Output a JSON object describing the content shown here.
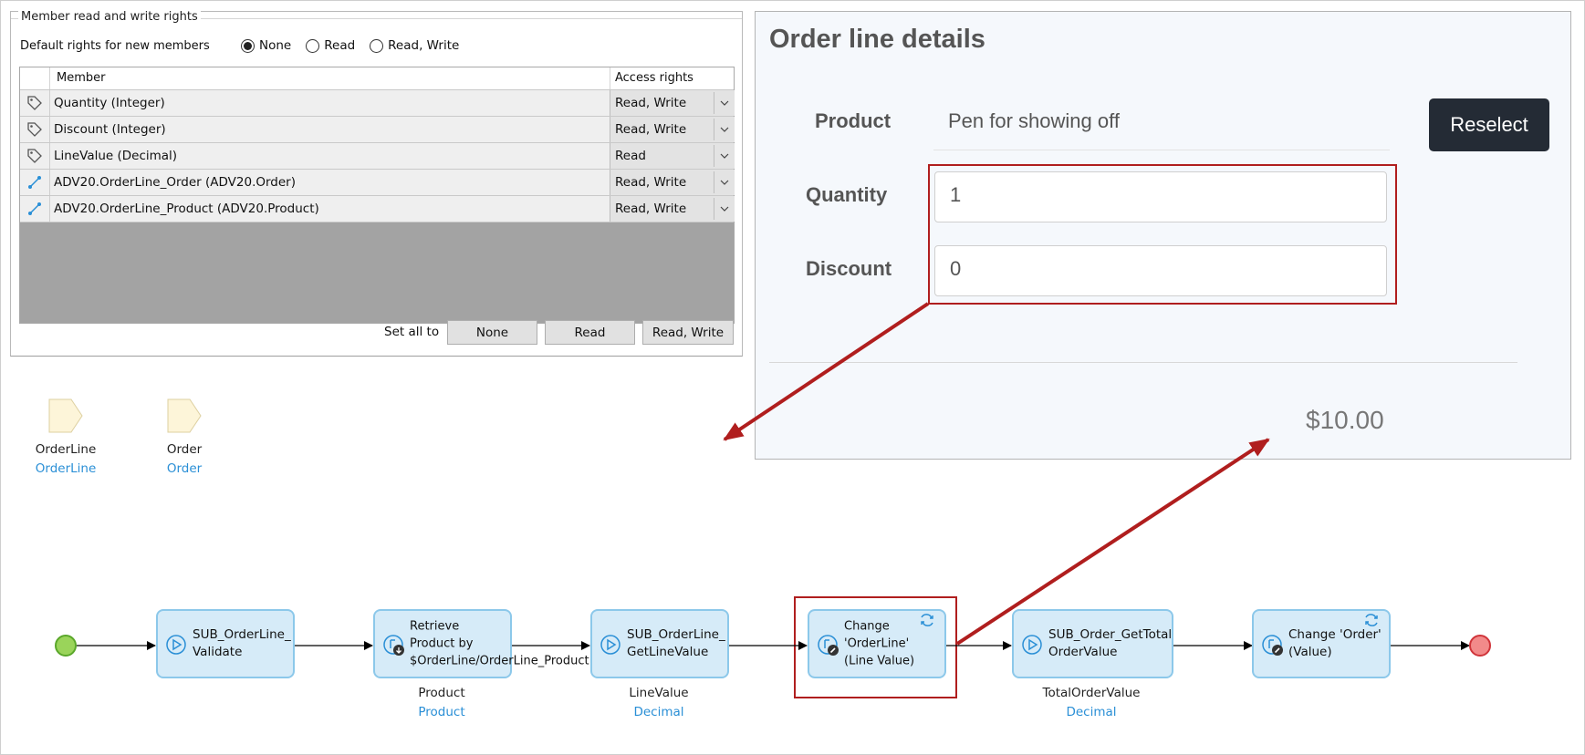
{
  "rights_panel": {
    "group_title": "Member read and write rights",
    "default_label": "Default rights for new members",
    "radio_options": [
      "None",
      "Read",
      "Read, Write"
    ],
    "selected_option": "None",
    "columns": {
      "member": "Member",
      "access": "Access rights"
    },
    "rows": [
      {
        "icon": "attribute-tag-icon",
        "member": "Quantity (Integer)",
        "access": "Read, Write"
      },
      {
        "icon": "attribute-tag-icon",
        "member": "Discount (Integer)",
        "access": "Read, Write"
      },
      {
        "icon": "attribute-tag-icon",
        "member": "LineValue (Decimal)",
        "access": "Read"
      },
      {
        "icon": "association-icon",
        "member": "ADV20.OrderLine_Order (ADV20.Order)",
        "access": "Read, Write"
      },
      {
        "icon": "association-icon",
        "member": "ADV20.OrderLine_Product (ADV20.Product)",
        "access": "Read, Write"
      }
    ],
    "set_all_label": "Set all to",
    "set_all_buttons": [
      "None",
      "Read",
      "Read, Write"
    ]
  },
  "parameters": [
    {
      "name": "OrderLine",
      "type": "OrderLine"
    },
    {
      "name": "Order",
      "type": "Order"
    }
  ],
  "form": {
    "title": "Order line details",
    "product_label": "Product",
    "product_value": "Pen for showing off",
    "reselect_label": "Reselect",
    "quantity_label": "Quantity",
    "quantity_value": "1",
    "discount_label": "Discount",
    "discount_value": "0",
    "total": "$10.00"
  },
  "microflow": {
    "activities": [
      {
        "kind": "submicroflow",
        "text": "SUB_OrderLine_ Validate"
      },
      {
        "kind": "retrieve",
        "text": "Retrieve Product by $OrderLine/OrderLine_Product",
        "output_name": "Product",
        "output_type": "Product"
      },
      {
        "kind": "submicroflow",
        "text": "SUB_OrderLine_ GetLineValue",
        "output_name": "LineValue",
        "output_type": "Decimal"
      },
      {
        "kind": "change",
        "text": "Change 'OrderLine' (Line Value)"
      },
      {
        "kind": "submicroflow",
        "text": "SUB_Order_GetTotal OrderValue",
        "output_name": "TotalOrderValue",
        "output_type": "Decimal"
      },
      {
        "kind": "change",
        "text": "Change 'Order' (Value)"
      }
    ]
  },
  "colors": {
    "highlight": "#b01e1e",
    "activity_fill": "#d6ebf8",
    "activity_border": "#8cc8ea",
    "type_text": "#2a8fd6",
    "start_event": "#9ad45a",
    "end_event": "#f28a8a",
    "button_dark": "#242b35"
  }
}
